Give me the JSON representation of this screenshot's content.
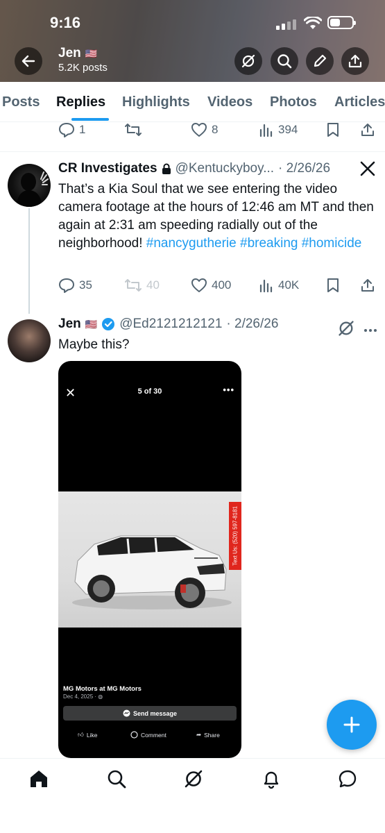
{
  "status_bar": {
    "time": "9:16"
  },
  "profile": {
    "name": "Jen",
    "flag": "🇺🇸",
    "posts_count": "5.2K posts"
  },
  "tabs": [
    {
      "label": "Posts"
    },
    {
      "label": "Replies"
    },
    {
      "label": "Highlights"
    },
    {
      "label": "Videos"
    },
    {
      "label": "Photos"
    },
    {
      "label": "Articles"
    }
  ],
  "active_tab": "Replies",
  "prev_tweet_actions": {
    "replies": "1",
    "likes": "8",
    "views": "394"
  },
  "tweet1": {
    "name": "CR Investigates",
    "handle": "@Kentuckyboy...",
    "date": "· 2/26/26",
    "text_plain": "That’s a Kia Soul that we see entering the video camera footage at the hours of 12:46 am MT and then again at 2:31 am speeding radially out of the neighborhood! ",
    "hashtags": [
      "#nancygutherie",
      "#breaking",
      "#homicide"
    ],
    "actions": {
      "replies": "35",
      "reposts": "40",
      "likes": "400",
      "views": "40K"
    }
  },
  "tweet2": {
    "name": "Jen",
    "flag": "🇺🇸",
    "handle": "@Ed2121212121",
    "date": "· 2/26/26",
    "text": "Maybe this?",
    "media": {
      "counter": "5 of 30",
      "close": "✕",
      "more": "•••",
      "tag": "Text Us: (520) 597-8181",
      "seller": "MG Motors at MG Motors",
      "post_date": "Dec 4, 2025 ·",
      "send_message": "Send message",
      "like": "Like",
      "comment": "Comment",
      "share": "Share"
    }
  },
  "colors": {
    "accent": "#1d9bf0",
    "text": "#0f1419",
    "muted": "#536471"
  }
}
